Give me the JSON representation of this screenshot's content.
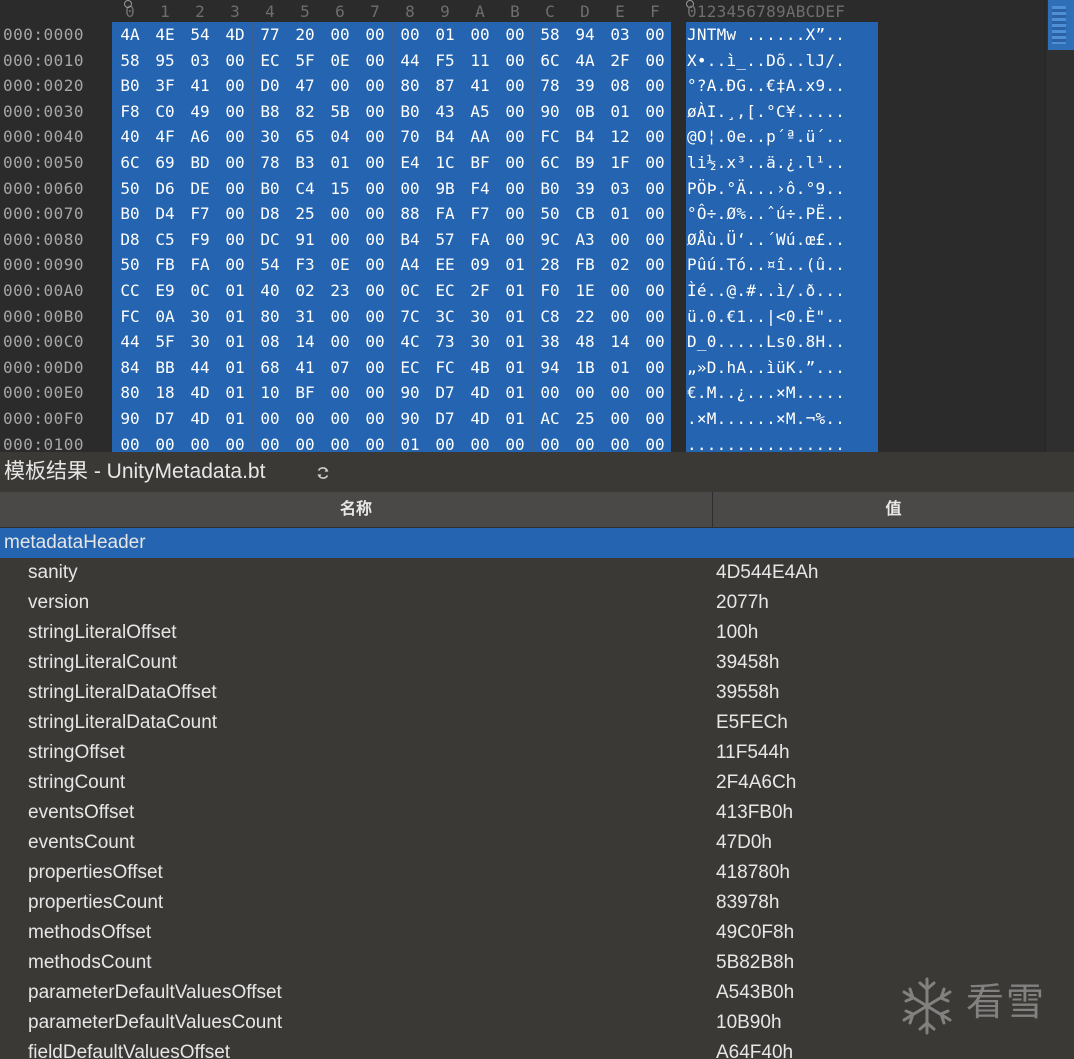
{
  "hex_editor": {
    "column_headers": [
      "0",
      "1",
      "2",
      "3",
      "4",
      "5",
      "6",
      "7",
      "8",
      "9",
      "A",
      "B",
      "C",
      "D",
      "E",
      "F"
    ],
    "ascii_header": "0123456789ABCDEF",
    "rows": [
      {
        "offset": "000:0000",
        "bytes": [
          "4A",
          "4E",
          "54",
          "4D",
          "77",
          "20",
          "00",
          "00",
          "00",
          "01",
          "00",
          "00",
          "58",
          "94",
          "03",
          "00"
        ],
        "ascii": "JNTMw ......X”.."
      },
      {
        "offset": "000:0010",
        "bytes": [
          "58",
          "95",
          "03",
          "00",
          "EC",
          "5F",
          "0E",
          "00",
          "44",
          "F5",
          "11",
          "00",
          "6C",
          "4A",
          "2F",
          "00"
        ],
        "ascii": "X•..ì_..Dõ..lJ/."
      },
      {
        "offset": "000:0020",
        "bytes": [
          "B0",
          "3F",
          "41",
          "00",
          "D0",
          "47",
          "00",
          "00",
          "80",
          "87",
          "41",
          "00",
          "78",
          "39",
          "08",
          "00"
        ],
        "ascii": "°?A.ÐG..€‡A.x9.."
      },
      {
        "offset": "000:0030",
        "bytes": [
          "F8",
          "C0",
          "49",
          "00",
          "B8",
          "82",
          "5B",
          "00",
          "B0",
          "43",
          "A5",
          "00",
          "90",
          "0B",
          "01",
          "00"
        ],
        "ascii": "øÀI.¸‚[.°C¥....."
      },
      {
        "offset": "000:0040",
        "bytes": [
          "40",
          "4F",
          "A6",
          "00",
          "30",
          "65",
          "04",
          "00",
          "70",
          "B4",
          "AA",
          "00",
          "FC",
          "B4",
          "12",
          "00"
        ],
        "ascii": "@O¦.0e..p´ª.ü´.."
      },
      {
        "offset": "000:0050",
        "bytes": [
          "6C",
          "69",
          "BD",
          "00",
          "78",
          "B3",
          "01",
          "00",
          "E4",
          "1C",
          "BF",
          "00",
          "6C",
          "B9",
          "1F",
          "00"
        ],
        "ascii": "li½.x³..ä.¿.l¹.."
      },
      {
        "offset": "000:0060",
        "bytes": [
          "50",
          "D6",
          "DE",
          "00",
          "B0",
          "C4",
          "15",
          "00",
          "00",
          "9B",
          "F4",
          "00",
          "B0",
          "39",
          "03",
          "00"
        ],
        "ascii": "PÖÞ.°Ä...›ô.°9.."
      },
      {
        "offset": "000:0070",
        "bytes": [
          "B0",
          "D4",
          "F7",
          "00",
          "D8",
          "25",
          "00",
          "00",
          "88",
          "FA",
          "F7",
          "00",
          "50",
          "CB",
          "01",
          "00"
        ],
        "ascii": "°Ô÷.Ø%..ˆú÷.PË.."
      },
      {
        "offset": "000:0080",
        "bytes": [
          "D8",
          "C5",
          "F9",
          "00",
          "DC",
          "91",
          "00",
          "00",
          "B4",
          "57",
          "FA",
          "00",
          "9C",
          "A3",
          "00",
          "00"
        ],
        "ascii": "ØÅù.Ü‘..´Wú.œ£.."
      },
      {
        "offset": "000:0090",
        "bytes": [
          "50",
          "FB",
          "FA",
          "00",
          "54",
          "F3",
          "0E",
          "00",
          "A4",
          "EE",
          "09",
          "01",
          "28",
          "FB",
          "02",
          "00"
        ],
        "ascii": "Pûú.Tó..¤î..(û.."
      },
      {
        "offset": "000:00A0",
        "bytes": [
          "CC",
          "E9",
          "0C",
          "01",
          "40",
          "02",
          "23",
          "00",
          "0C",
          "EC",
          "2F",
          "01",
          "F0",
          "1E",
          "00",
          "00"
        ],
        "ascii": "Ìé..@.#..ì/.ð..."
      },
      {
        "offset": "000:00B0",
        "bytes": [
          "FC",
          "0A",
          "30",
          "01",
          "80",
          "31",
          "00",
          "00",
          "7C",
          "3C",
          "30",
          "01",
          "C8",
          "22",
          "00",
          "00"
        ],
        "ascii": "ü.0.€1..|<0.È\".."
      },
      {
        "offset": "000:00C0",
        "bytes": [
          "44",
          "5F",
          "30",
          "01",
          "08",
          "14",
          "00",
          "00",
          "4C",
          "73",
          "30",
          "01",
          "38",
          "48",
          "14",
          "00"
        ],
        "ascii": "D_0.....Ls0.8H.."
      },
      {
        "offset": "000:00D0",
        "bytes": [
          "84",
          "BB",
          "44",
          "01",
          "68",
          "41",
          "07",
          "00",
          "EC",
          "FC",
          "4B",
          "01",
          "94",
          "1B",
          "01",
          "00"
        ],
        "ascii": "„»D.hA..ìüK.”..."
      },
      {
        "offset": "000:00E0",
        "bytes": [
          "80",
          "18",
          "4D",
          "01",
          "10",
          "BF",
          "00",
          "00",
          "90",
          "D7",
          "4D",
          "01",
          "00",
          "00",
          "00",
          "00"
        ],
        "ascii": "€.M..¿...×M....."
      },
      {
        "offset": "000:00F0",
        "bytes": [
          "90",
          "D7",
          "4D",
          "01",
          "00",
          "00",
          "00",
          "00",
          "90",
          "D7",
          "4D",
          "01",
          "AC",
          "25",
          "00",
          "00"
        ],
        "ascii": ".×M......×M.¬%.."
      },
      {
        "offset": "000:0100",
        "bytes": [
          "00",
          "00",
          "00",
          "00",
          "00",
          "00",
          "00",
          "00",
          "01",
          "00",
          "00",
          "00",
          "00",
          "00",
          "00",
          "00"
        ],
        "ascii": "................"
      }
    ]
  },
  "template_panel": {
    "title": "模板结果 - UnityMetadata.bt",
    "refresh_icon": "refresh-icon",
    "columns": {
      "name": "名称",
      "value": "值"
    },
    "root": {
      "name": "metadataHeader",
      "value": ""
    },
    "fields": [
      {
        "name": "sanity",
        "value": "4D544E4Ah"
      },
      {
        "name": "version",
        "value": "2077h"
      },
      {
        "name": "stringLiteralOffset",
        "value": "100h"
      },
      {
        "name": "stringLiteralCount",
        "value": "39458h"
      },
      {
        "name": "stringLiteralDataOffset",
        "value": "39558h"
      },
      {
        "name": "stringLiteralDataCount",
        "value": "E5FECh"
      },
      {
        "name": "stringOffset",
        "value": "11F544h"
      },
      {
        "name": "stringCount",
        "value": "2F4A6Ch"
      },
      {
        "name": "eventsOffset",
        "value": "413FB0h"
      },
      {
        "name": "eventsCount",
        "value": "47D0h"
      },
      {
        "name": "propertiesOffset",
        "value": "418780h"
      },
      {
        "name": "propertiesCount",
        "value": "83978h"
      },
      {
        "name": "methodsOffset",
        "value": "49C0F8h"
      },
      {
        "name": "methodsCount",
        "value": "5B82B8h"
      },
      {
        "name": "parameterDefaultValuesOffset",
        "value": "A543B0h"
      },
      {
        "name": "parameterDefaultValuesCount",
        "value": "10B90h"
      },
      {
        "name": "fieldDefaultValuesOffset",
        "value": "A64F40h"
      }
    ]
  },
  "watermark": {
    "text": "看雪",
    "icon": "snowflake-icon"
  },
  "colors": {
    "selection": "#2464b0",
    "hex_background": "#2b2b2b",
    "panel_background": "#3a3936",
    "ruler_text": "#6e6e6e"
  }
}
